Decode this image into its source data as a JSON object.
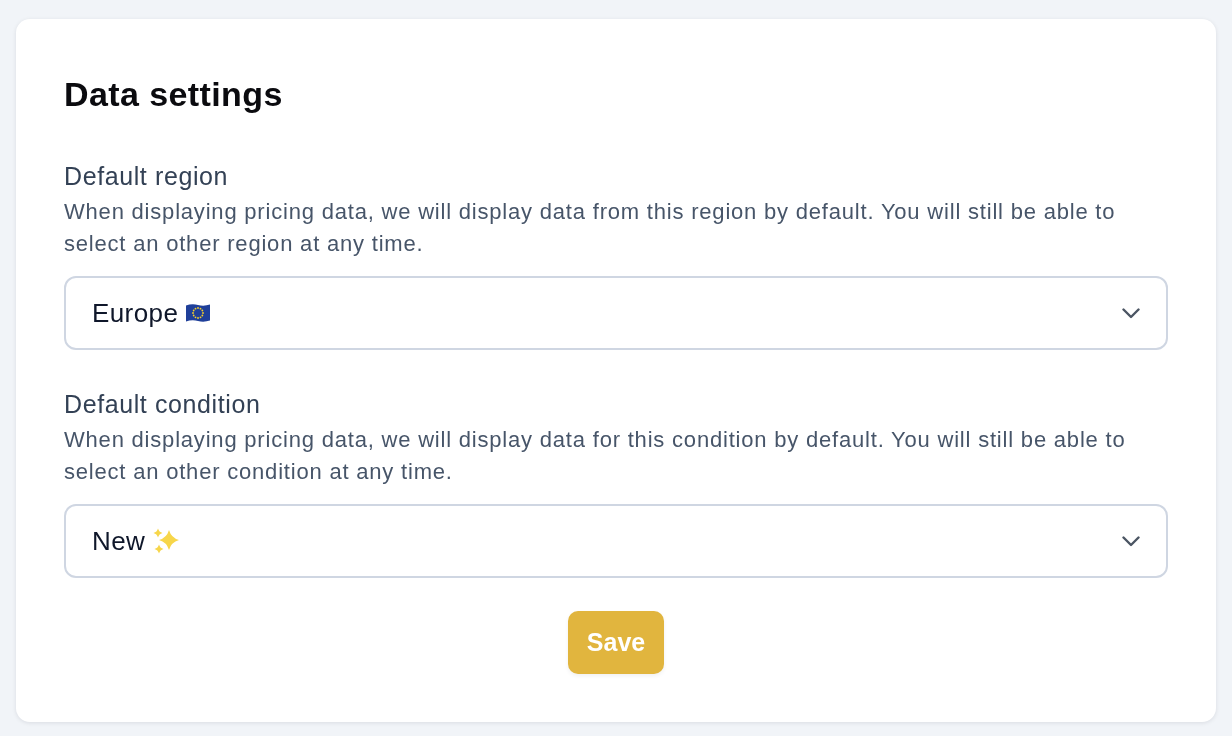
{
  "title": "Data settings",
  "sections": [
    {
      "kind": "region",
      "label": "Default region",
      "description": "When displaying pricing data, we will display data from this region by default. You will still be able to select an other region at any time.",
      "select": {
        "value": "Europe"
      }
    },
    {
      "kind": "condition",
      "label": "Default condition",
      "description": "When displaying pricing data, we will display data for this condition by default. You will still be able to select an other condition at any time.",
      "select": {
        "value": "New"
      }
    }
  ],
  "save_button": "Save"
}
